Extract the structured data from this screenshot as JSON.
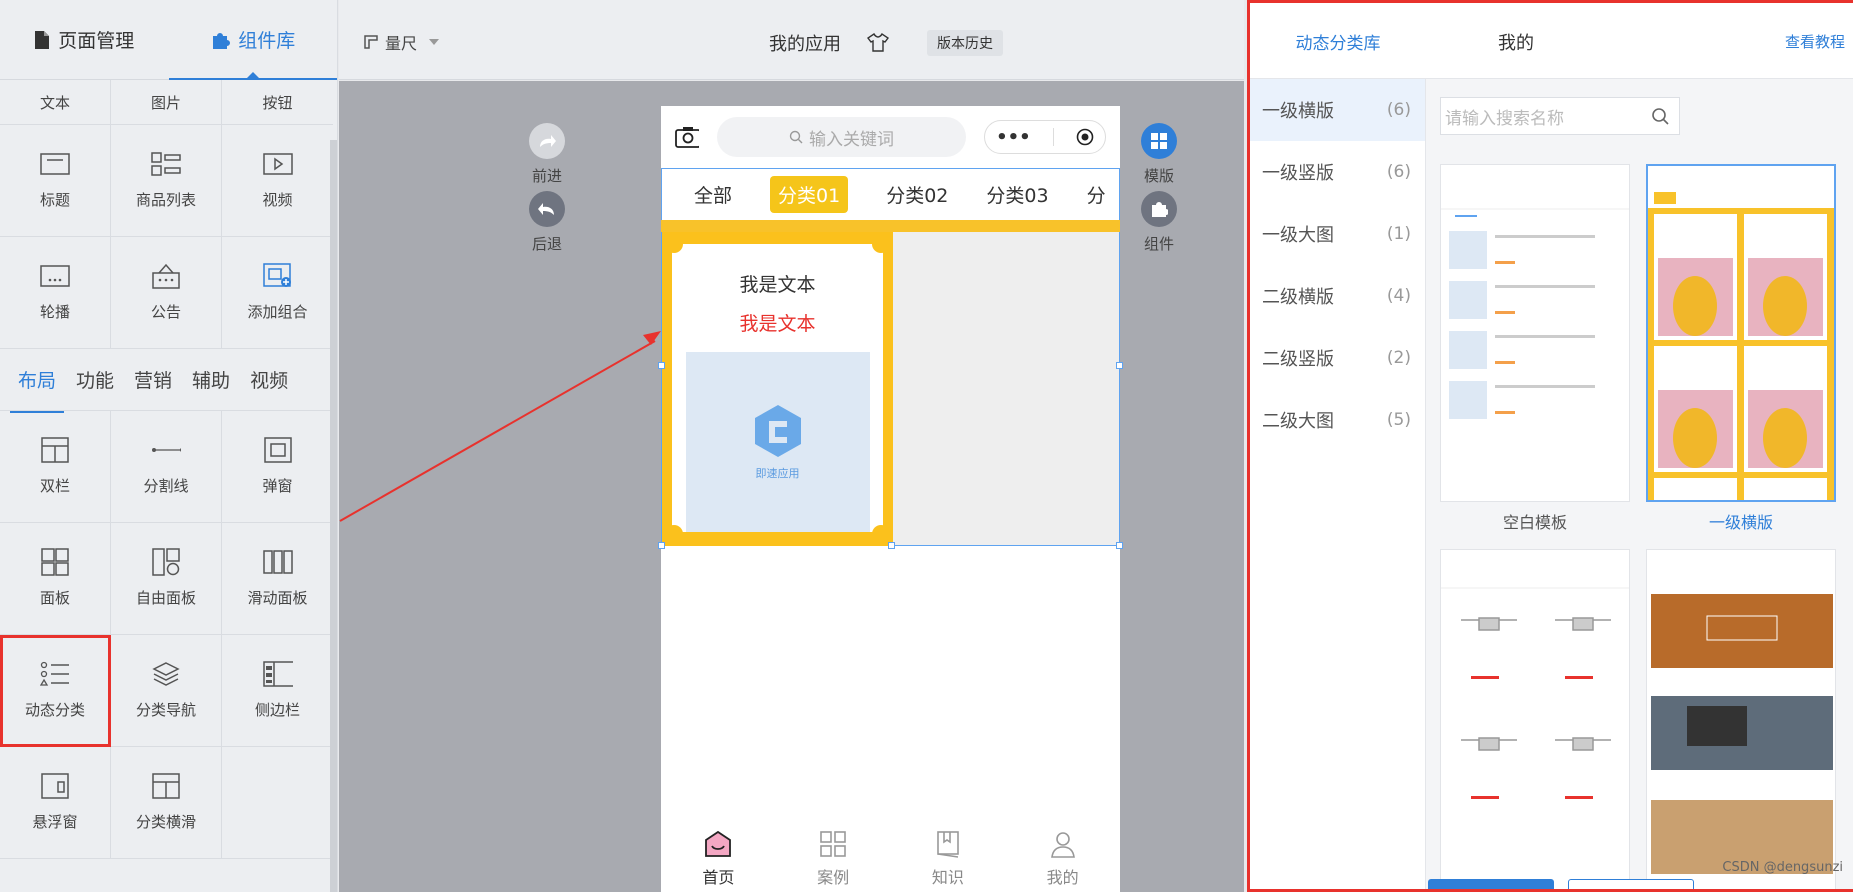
{
  "left": {
    "tabs": [
      "页面管理",
      "组件库"
    ],
    "basic_row": [
      "文本",
      "图片",
      "按钮"
    ],
    "basic": [
      "标题",
      "商品列表",
      "视频",
      "轮播",
      "公告",
      "添加组合"
    ],
    "subtabs": [
      "布局",
      "功能",
      "营销",
      "辅助",
      "视频"
    ],
    "layout": [
      "双栏",
      "分割线",
      "弹窗",
      "面板",
      "自由面板",
      "滑动面板",
      "动态分类",
      "分类导航",
      "侧边栏",
      "悬浮窗",
      "分类横滑"
    ]
  },
  "topbar": {
    "ruler": "量尺",
    "app_title": "我的应用",
    "history": "版本历史"
  },
  "canvas": {
    "forward": "前进",
    "back": "后退",
    "template": "模版",
    "component": "组件",
    "search_placeholder": "输入关键词",
    "tabs": [
      "全部",
      "分类01",
      "分类02",
      "分类03",
      "分"
    ],
    "card_text1": "我是文本",
    "card_text2": "我是文本",
    "card_img_label": "即速应用",
    "tabbar": [
      "首页",
      "案例",
      "知识",
      "我的"
    ]
  },
  "right": {
    "lib": "动态分类库",
    "mine": "我的",
    "tutorial": "查看教程",
    "categories": [
      {
        "name": "一级横版",
        "count": "(6)"
      },
      {
        "name": "一级竖版",
        "count": "(6)"
      },
      {
        "name": "一级大图",
        "count": "(1)"
      },
      {
        "name": "二级横版",
        "count": "(4)"
      },
      {
        "name": "二级竖版",
        "count": "(2)"
      },
      {
        "name": "二级大图",
        "count": "(5)"
      }
    ],
    "search_placeholder": "请输入搜索名称",
    "templates": [
      "空白模板",
      "一级横版"
    ]
  },
  "watermark": "CSDN @dengsunzi",
  "colors": {
    "accent": "#2f7fd8",
    "highlight": "#e8322d",
    "yellow": "#f8c22a"
  }
}
